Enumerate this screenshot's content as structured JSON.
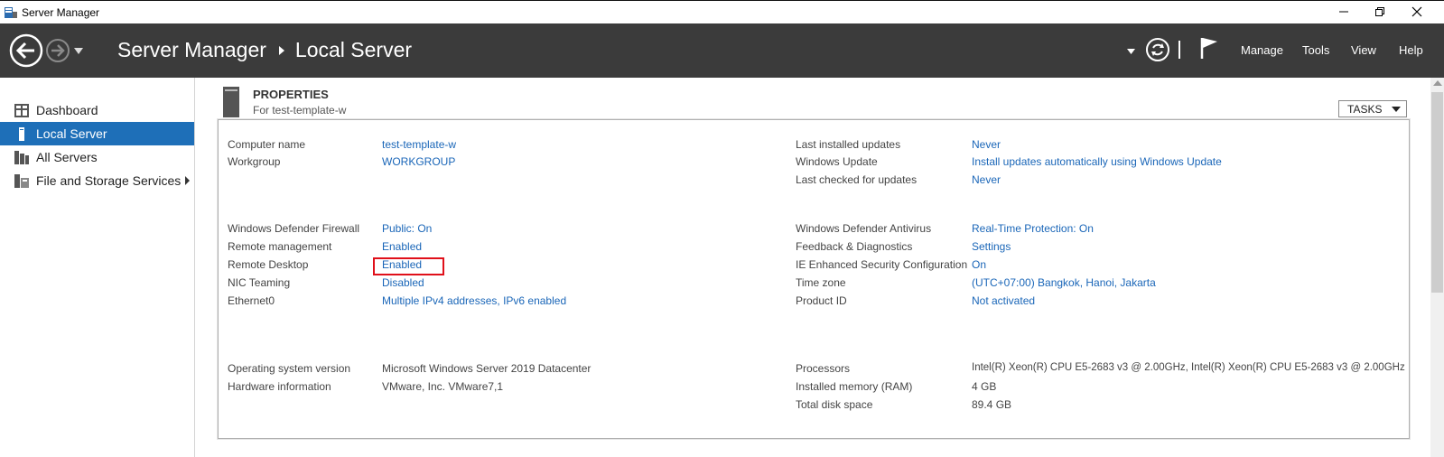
{
  "window": {
    "title": "Server Manager"
  },
  "header": {
    "breadcrumb_root": "Server Manager",
    "breadcrumb_current": "Local Server",
    "menu": [
      "Manage",
      "Tools",
      "View",
      "Help"
    ]
  },
  "sidebar": {
    "items": [
      {
        "label": "Dashboard",
        "icon": "dashboard-icon",
        "active": false
      },
      {
        "label": "Local Server",
        "icon": "server-icon",
        "active": true
      },
      {
        "label": "All Servers",
        "icon": "servers-icon",
        "active": false
      },
      {
        "label": "File and Storage Services",
        "icon": "storage-icon",
        "active": false,
        "expandable": true
      }
    ]
  },
  "properties": {
    "title": "PROPERTIES",
    "subtitle": "For test-template-w",
    "tasks_label": "TASKS",
    "left": [
      {
        "label": "Computer name",
        "value": "test-template-w",
        "link": true
      },
      {
        "label": "Workgroup",
        "value": "WORKGROUP",
        "link": true
      },
      {
        "label": "Windows Defender Firewall",
        "value": "Public: On",
        "link": true
      },
      {
        "label": "Remote management",
        "value": "Enabled",
        "link": true
      },
      {
        "label": "Remote Desktop",
        "value": "Enabled",
        "link": true
      },
      {
        "label": "NIC Teaming",
        "value": "Disabled",
        "link": true
      },
      {
        "label": "Ethernet0",
        "value": "Multiple IPv4 addresses, IPv6 enabled",
        "link": true
      },
      {
        "label": "Operating system version",
        "value": "Microsoft Windows Server 2019 Datacenter",
        "link": false
      },
      {
        "label": "Hardware information",
        "value": "VMware, Inc. VMware7,1",
        "link": false
      }
    ],
    "right": [
      {
        "label": "Last installed updates",
        "value": "Never",
        "link": true
      },
      {
        "label": "Windows Update",
        "value": "Install updates automatically using Windows Update",
        "link": true
      },
      {
        "label": "Last checked for updates",
        "value": "Never",
        "link": true
      },
      {
        "label": "Windows Defender Antivirus",
        "value": "Real-Time Protection: On",
        "link": true
      },
      {
        "label": "Feedback & Diagnostics",
        "value": "Settings",
        "link": true
      },
      {
        "label": "IE Enhanced Security Configuration",
        "value": "On",
        "link": true
      },
      {
        "label": "Time zone",
        "value": "(UTC+07:00) Bangkok, Hanoi, Jakarta",
        "link": true
      },
      {
        "label": "Product ID",
        "value": "Not activated",
        "link": true
      },
      {
        "label": "Processors",
        "value": "Intel(R) Xeon(R) CPU E5-2683 v3 @ 2.00GHz, Intel(R) Xeon(R) CPU E5-2683 v3 @ 2.00GHz",
        "link": false
      },
      {
        "label": "Installed memory (RAM)",
        "value": "4 GB",
        "link": false
      },
      {
        "label": "Total disk space",
        "value": "89.4 GB",
        "link": false
      }
    ]
  },
  "colors": {
    "header_bg": "#3b3b3b",
    "sidebar_active": "#1e6fb8",
    "link": "#1a66b8",
    "highlight": "#e0101a"
  }
}
